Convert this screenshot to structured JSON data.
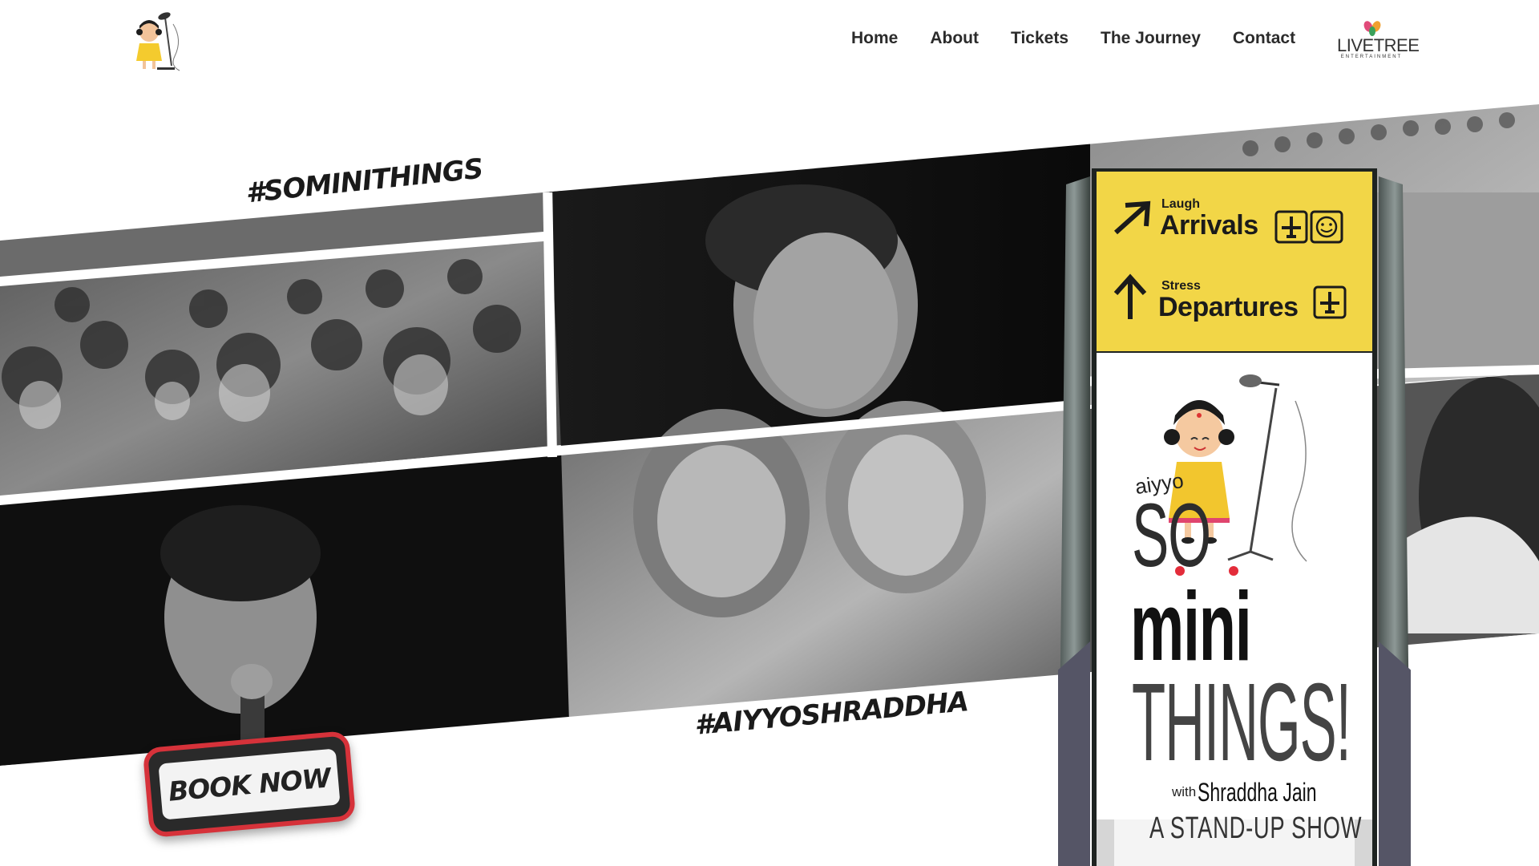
{
  "header": {
    "logo_alt": "Aiyyo So Mini Things mascot logo",
    "nav": [
      {
        "label": "Home"
      },
      {
        "label": "About"
      },
      {
        "label": "Tickets"
      },
      {
        "label": "The Journey"
      },
      {
        "label": "Contact"
      }
    ],
    "brand": {
      "name": "LIVETREE",
      "sub": "ENTERTAINMENT"
    }
  },
  "hero": {
    "hashtag_top": "#SOMINITHINGS",
    "hashtag_bottom": "#AIYYOSHRADDHA",
    "book_now_label": "BOOK NOW"
  },
  "signboard": {
    "row1_small": "Laugh",
    "row1_big": "Arrivals",
    "row2_small": "Stress",
    "row2_big": "Departures",
    "poster": {
      "aiyyo": "aiyyo",
      "so": "SO",
      "mini": "mini",
      "things": "THINGS!",
      "with": "with",
      "name": "Shraddha Jain",
      "show": "A STAND-UP SHOW"
    }
  },
  "colors": {
    "book_now_border": "#d6323a",
    "sign_yellow": "#f2d647",
    "nav_text": "#2b2b2b"
  }
}
